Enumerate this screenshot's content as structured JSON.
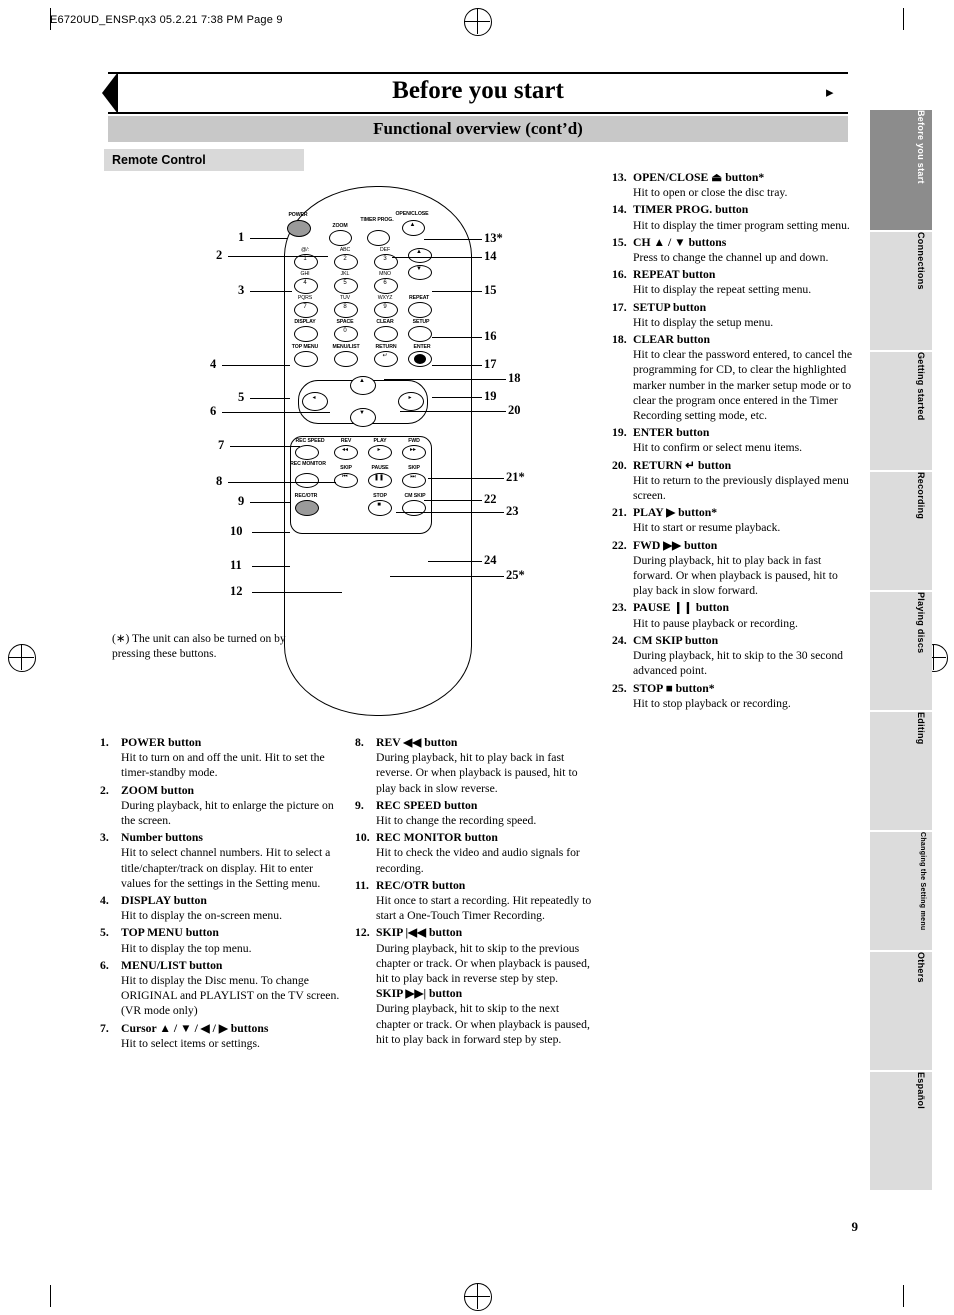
{
  "header_code": "E6720UD_ENSP.qx3   05.2.21 7:38 PM   Page 9",
  "title": "Before you start",
  "subtitle": "Functional overview (cont’d)",
  "section_label": "Remote Control",
  "page_number": "9",
  "footnote": "(∗) The unit can also be turned on by pressing these buttons.",
  "side_tabs": [
    {
      "label": "Before you start",
      "style": "dark"
    },
    {
      "label": "Connections",
      "style": "light"
    },
    {
      "label": "Getting started",
      "style": "light"
    },
    {
      "label": "Recording",
      "style": "light"
    },
    {
      "label": "Playing discs",
      "style": "light"
    },
    {
      "label": "Editing",
      "style": "light"
    },
    {
      "label": "Changing the Setting menu",
      "style": "light"
    },
    {
      "label": "Others",
      "style": "light"
    },
    {
      "label": "Español",
      "style": "light"
    }
  ],
  "remote": {
    "labels": {
      "power": "POWER",
      "zoom": "ZOOM",
      "timer_prog": "TIMER PROG.",
      "open_close": "OPEN/CLOSE",
      "k1": "@/:",
      "k2": "ABC",
      "k3": "DEF",
      "k4": "GHI",
      "k5": "JKL",
      "k6": "MNO",
      "k7": "PQRS",
      "k8": "TUV",
      "k9": "WXYZ",
      "ch": "CH",
      "repeat": "REPEAT",
      "display": "DISPLAY",
      "space": "SPACE",
      "clear": "CLEAR",
      "setup": "SETUP",
      "top_menu": "TOP MENU",
      "menu_list": "MENU/LIST",
      "return": "RETURN",
      "enter": "ENTER",
      "rec_speed": "REC SPEED",
      "rev": "REV",
      "play": "PLAY",
      "fwd": "FWD",
      "rec_monitor": "REC MONITOR",
      "skip_l": "SKIP",
      "pause": "PAUSE",
      "skip_r": "SKIP",
      "rec_otr": "REC/OTR",
      "stop": "STOP",
      "cm_skip": "CM SKIP",
      "n1": "1",
      "n2": "2",
      "n3": "3",
      "n4": "4",
      "n5": "5",
      "n6": "6",
      "n7": "7",
      "n8": "8",
      "n9": "9",
      "n0": "0"
    },
    "callouts": [
      "1",
      "2",
      "3",
      "4",
      "5",
      "6",
      "7",
      "8",
      "9",
      "10",
      "11",
      "12",
      "13*",
      "14",
      "15",
      "16",
      "17",
      "18",
      "19",
      "20",
      "21*",
      "22",
      "23",
      "24",
      "25*"
    ]
  },
  "entries": [
    {
      "n": "1.",
      "title": "POWER button",
      "text": "Hit to turn on and off the unit. Hit to set the timer-standby mode."
    },
    {
      "n": "2.",
      "title": "ZOOM button",
      "text": "During playback, hit to enlarge the picture on the screen."
    },
    {
      "n": "3.",
      "title": "Number buttons",
      "text": "Hit to select channel numbers. Hit to select a title/chapter/track on display. Hit to enter values for the settings in the Setting menu."
    },
    {
      "n": "4.",
      "title": "DISPLAY button",
      "text": "Hit to display the on-screen menu."
    },
    {
      "n": "5.",
      "title": "TOP MENU button",
      "text": "Hit to display the top menu."
    },
    {
      "n": "6.",
      "title": "MENU/LIST button",
      "text": "Hit to display the Disc menu. To change ORIGINAL and PLAYLIST on the TV screen. (VR mode only)"
    },
    {
      "n": "7.",
      "title": "Cursor ▲ / ▼ / ◀ / ▶ buttons",
      "text": "Hit to select items or settings."
    },
    {
      "n": "8.",
      "title": "REV ◀◀ button",
      "text": "During playback, hit to play back in fast reverse. Or when playback is paused, hit to play back in slow reverse."
    },
    {
      "n": "9.",
      "title": "REC SPEED button",
      "text": "Hit to change the recording speed."
    },
    {
      "n": "10.",
      "title": "REC MONITOR button",
      "text": "Hit to check the video and audio signals for recording."
    },
    {
      "n": "11.",
      "title": "REC/OTR button",
      "text": "Hit once to start a recording. Hit repeatedly to start a One-Touch Timer Recording."
    },
    {
      "n": "12.",
      "title": "SKIP |◀◀ button",
      "text": "During playback, hit to skip to the previous chapter or track. Or when playback is paused, hit to play back in reverse step by step.",
      "title2": "SKIP ▶▶| button",
      "text2": "During playback, hit to skip to the next chapter or track. Or when playback is paused, hit to play back in forward step by step."
    },
    {
      "n": "13.",
      "title": "OPEN/CLOSE ⏏ button*",
      "text": "Hit to open or close the disc tray."
    },
    {
      "n": "14.",
      "title": "TIMER PROG. button",
      "text": "Hit to display the timer program setting menu."
    },
    {
      "n": "15.",
      "title": "CH ▲ / ▼ buttons",
      "text": "Press to change the channel up and down."
    },
    {
      "n": "16.",
      "title": "REPEAT button",
      "text": "Hit to display the repeat setting menu."
    },
    {
      "n": "17.",
      "title": "SETUP button",
      "text": "Hit to display the setup menu."
    },
    {
      "n": "18.",
      "title": "CLEAR button",
      "text": "Hit to clear the password entered, to cancel the programming for CD, to clear the highlighted marker number in the marker setup mode or to clear the program once entered in the Timer Recording setting mode, etc."
    },
    {
      "n": "19.",
      "title": "ENTER button",
      "text": "Hit to confirm or select menu items."
    },
    {
      "n": "20.",
      "title": "RETURN ↵ button",
      "text": "Hit to return to the previously displayed menu screen."
    },
    {
      "n": "21.",
      "title": "PLAY ▶ button*",
      "text": "Hit to start or resume playback."
    },
    {
      "n": "22.",
      "title": "FWD ▶▶ button",
      "text": "During playback, hit to play back in fast forward. Or when playback is paused, hit to play back in slow forward."
    },
    {
      "n": "23.",
      "title": "PAUSE ❙❙ button",
      "text": "Hit to pause playback or recording."
    },
    {
      "n": "24.",
      "title": "CM SKIP button",
      "text": "During playback, hit to skip to the 30 second advanced point."
    },
    {
      "n": "25.",
      "title": "STOP ■ button*",
      "text": "Hit to stop playback or recording."
    }
  ]
}
